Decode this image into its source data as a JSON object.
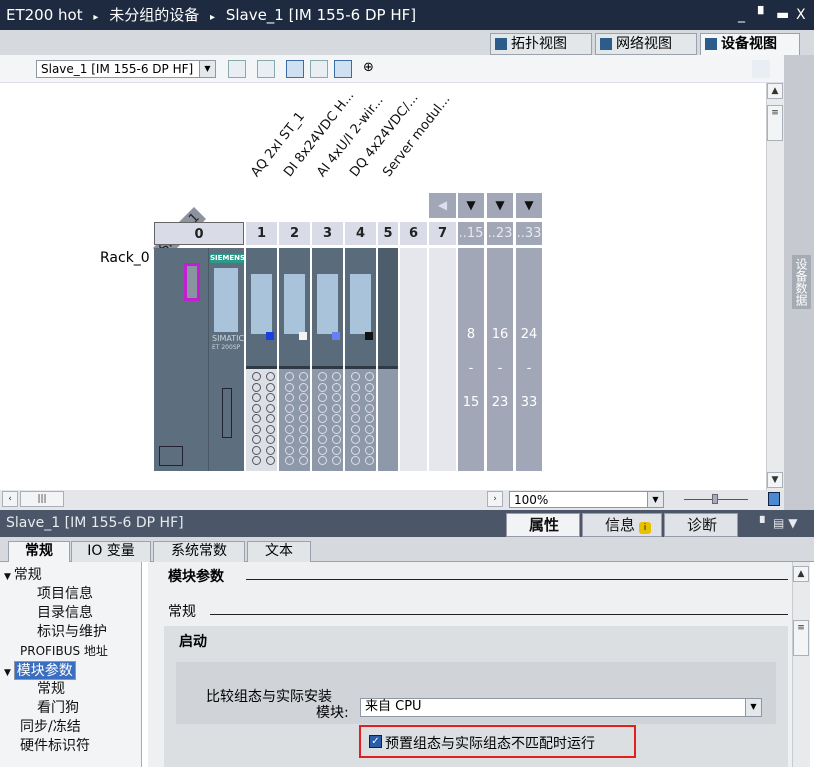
{
  "title_bar": {
    "crumbs": [
      "ET200 hot",
      "未分组的设备",
      "Slave_1 [IM 155-6 DP HF]"
    ],
    "separator": "▸",
    "controls": [
      "_",
      "▘",
      "▬",
      "X"
    ]
  },
  "view_tabs": [
    {
      "label": "拓扑视图",
      "icon": "topology-icon"
    },
    {
      "label": "网络视图",
      "icon": "network-icon"
    },
    {
      "label": "设备视图",
      "icon": "device-icon",
      "active": true
    }
  ],
  "toolbar": {
    "device_select": "Slave_1 [IM 155-6 DP HF]",
    "zoom": "100%"
  },
  "rack": {
    "name": "Rack_0",
    "device_label": "Slave_1",
    "module_labels": [
      "AQ 2xI ST_1",
      "DI 8x24VDC H...",
      "AI 4xU/I 2-wir...",
      "DQ 4x24VDC/...",
      "Server modul..."
    ],
    "slots": [
      "0",
      "1",
      "2",
      "3",
      "4",
      "5",
      "6",
      "7",
      "..15",
      "..23",
      "..33"
    ],
    "ranges": [
      {
        "from": "8",
        "dash": "-",
        "to": "15"
      },
      {
        "from": "16",
        "dash": "-",
        "to": "23"
      },
      {
        "from": "24",
        "dash": "-",
        "to": "33"
      }
    ],
    "module_brand": "SIEMENS",
    "module_text": [
      "SIMATIC",
      "ET 200SP"
    ],
    "led_colors": [
      "#1a3fe0",
      "#f4f4f4",
      "#6a7ff0",
      "#111111"
    ],
    "highlight_color": "#c020d0"
  },
  "side_panel": {
    "label": "设备数据"
  },
  "inspector": {
    "title": "Slave_1 [IM 155-6 DP HF]",
    "tabs": [
      {
        "label": "属性",
        "active": true
      },
      {
        "label": "信息"
      },
      {
        "label": "诊断"
      }
    ],
    "sub_tabs": [
      {
        "label": "常规",
        "active": true
      },
      {
        "label": "IO 变量"
      },
      {
        "label": "系统常数"
      },
      {
        "label": "文本"
      }
    ],
    "tree": [
      {
        "label": "常规",
        "level": 0,
        "expanded": true
      },
      {
        "label": "项目信息",
        "level": 1
      },
      {
        "label": "目录信息",
        "level": 1
      },
      {
        "label": "标识与维护",
        "level": 1
      },
      {
        "label": "PROFIBUS 地址",
        "level": 0
      },
      {
        "label": "模块参数",
        "level": 0,
        "expanded": true,
        "selected": true
      },
      {
        "label": "常规",
        "level": 1
      },
      {
        "label": "看门狗",
        "level": 1
      },
      {
        "label": "同步/冻结",
        "level": 0
      },
      {
        "label": "硬件标识符",
        "level": 0
      }
    ],
    "section_title": "模块参数",
    "subsection": "常规",
    "group": "启动",
    "compare_label_1": "比较组态与实际安装",
    "compare_label_2": "模块:",
    "compare_value": "来自 CPU",
    "checkbox_label": "预置组态与实际组态不匹配时运行",
    "checkbox_checked": true,
    "highlight_color": "#e02020"
  }
}
